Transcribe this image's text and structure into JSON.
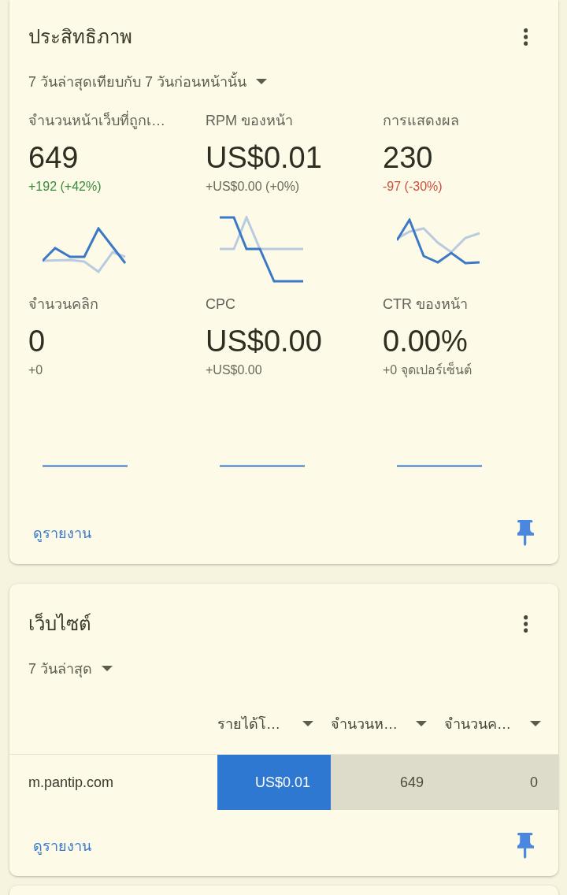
{
  "performance_card": {
    "title": "ประสิทธิภาพ",
    "period": "7 วันล่าสุดเทียบกับ 7 วันก่อนหน้านั้น",
    "metrics": [
      {
        "label": "จำนวนหน้าเว็บที่ถูกเ…",
        "value": "649",
        "change": "+192 (+42%)",
        "color": "#3a8a3e"
      },
      {
        "label": "RPM ของหน้า",
        "value": "US$0.01",
        "change": "+US$0.00 (+0%)",
        "color": "#6a6a5c"
      },
      {
        "label": "การแสดงผล",
        "value": "230",
        "change": "-97 (-30%)",
        "color": "#cc4f3a"
      },
      {
        "label": "จำนวนคลิก",
        "value": "0",
        "change": "+0",
        "color": "#6a6a5c"
      },
      {
        "label": "CPC",
        "value": "US$0.00",
        "change": "+US$0.00",
        "color": "#6a6a5c"
      },
      {
        "label": "CTR ของหน้า",
        "value": "0.00%",
        "change": "+0 จุดเปอร์เซ็นต์",
        "color": "#6a6a5c"
      }
    ],
    "link": "ดูรายงาน"
  },
  "sites_card": {
    "title": "เว็บไซต์",
    "period": "7 วันล่าสุด",
    "table": {
      "columns": [
        {
          "label": "รายได้โ…",
          "selected": true
        },
        {
          "label": "จำนวนห…",
          "selected": false
        },
        {
          "label": "จำนวนค…",
          "selected": false
        }
      ],
      "rows": [
        {
          "site": "m.pantip.com",
          "values": [
            "US$0.01",
            "649",
            "0"
          ]
        }
      ]
    },
    "link": "ดูรายงาน"
  }
}
